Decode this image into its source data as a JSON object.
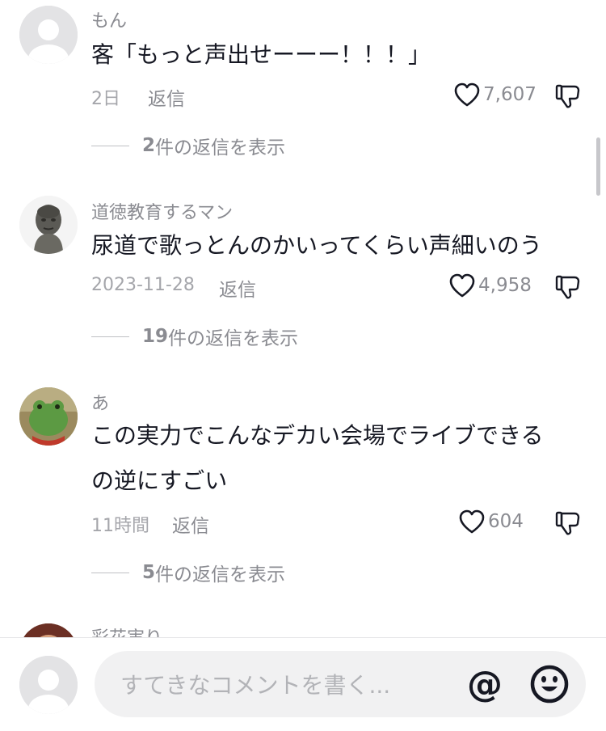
{
  "comments": [
    {
      "username": "もん",
      "text_lines": [
        "客「もっと声出せーーー！！！」"
      ],
      "time": "2日",
      "reply_label": "返信",
      "likes": "7,607",
      "view_replies": {
        "count": "2",
        "suffix": "件の返信を表示"
      },
      "avatar": "default-avatar"
    },
    {
      "username": "道徳教育するマン",
      "text_lines": [
        "尿道で歌っとんのかいってくらい声細いのう"
      ],
      "time": "2023-11-28",
      "reply_label": "返信",
      "likes": "4,958",
      "view_replies": {
        "count": "19",
        "suffix": "件の返信を表示"
      },
      "avatar": "bust-statue-avatar"
    },
    {
      "username": "あ",
      "text_lines": [
        "この実力でこんなデカい会場でライブできる",
        "の逆にすごい"
      ],
      "time": "11時間",
      "reply_label": "返信",
      "likes": "604",
      "view_replies": {
        "count": "5",
        "suffix": "件の返信を表示"
      },
      "avatar": "frog-plush-avatar"
    },
    {
      "username": "彩花実り",
      "avatar": "photo-avatar"
    }
  ],
  "composer": {
    "placeholder": "すてきなコメントを書く...",
    "mention_symbol": "@"
  },
  "colors": {
    "text": "#161823",
    "muted": "#8a8b91",
    "input_bg": "#f1f1f2"
  }
}
